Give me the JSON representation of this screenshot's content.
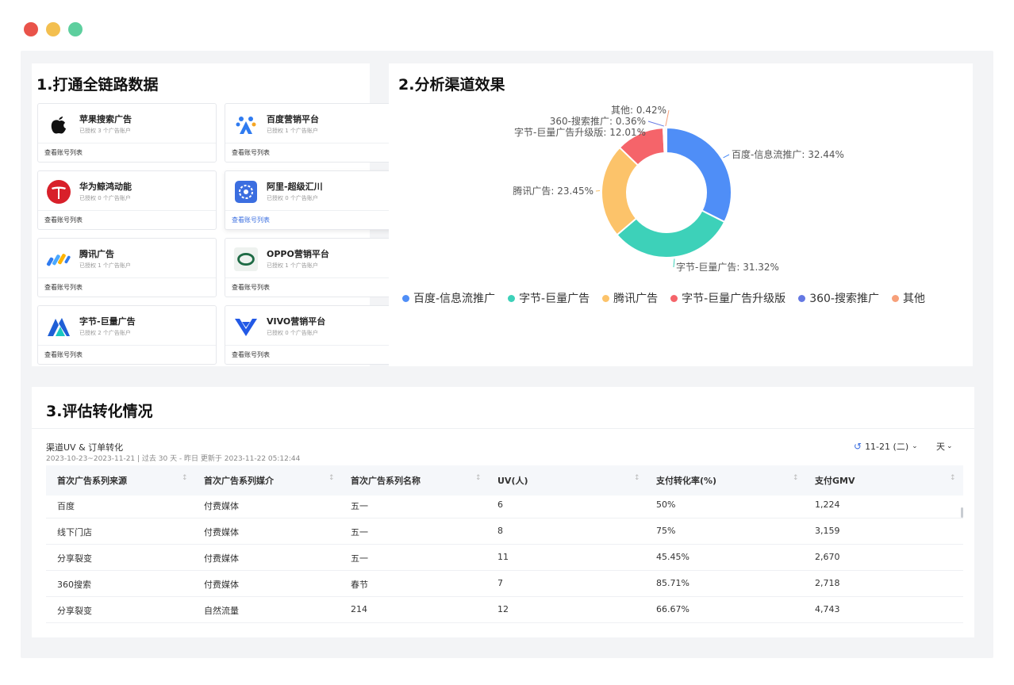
{
  "window": {
    "dots": [
      "#e9534a",
      "#f3bf4f",
      "#5dcf9e"
    ]
  },
  "section1": {
    "title": "1.打通全链路数据",
    "channels": [
      {
        "name": "苹果搜索广告",
        "sub": "已授权 3 个广告账户",
        "link": "查看账号列表",
        "icon": "apple-icon"
      },
      {
        "name": "百度营销平台",
        "sub": "已授权 1 个广告账户",
        "link": "查看账号列表",
        "icon": "baidu-icon"
      },
      {
        "name": "华为鲸鸿动能",
        "sub": "已授权 0 个广告账户",
        "link": "查看账号列表",
        "icon": "huawei-icon"
      },
      {
        "name": "阿里-超级汇川",
        "sub": "已授权 0 个广告账户",
        "link": "查看账号列表",
        "icon": "ali-icon"
      },
      {
        "name": "腾讯广告",
        "sub": "已授权 1 个广告账户",
        "link": "查看账号列表",
        "icon": "tencent-icon"
      },
      {
        "name": "OPPO营销平台",
        "sub": "已授权 1 个广告账户",
        "link": "查看账号列表",
        "icon": "oppo-icon"
      },
      {
        "name": "字节-巨量广告",
        "sub": "已授权 2 个广告账户",
        "link": "查看账号列表",
        "icon": "bytedance-icon"
      },
      {
        "name": "VIVO营销平台",
        "sub": "已授权 0 个广告账户",
        "link": "查看账号列表",
        "icon": "vivo-icon"
      }
    ]
  },
  "section2": {
    "title": "2.分析渠道效果",
    "chart_data": {
      "type": "pie",
      "donut": true,
      "legend_position": "bottom",
      "slices": [
        {
          "name": "百度-信息流推广",
          "value": 32.44,
          "label": "百度-信息流推广: 32.44%",
          "color": "#4f8ef7"
        },
        {
          "name": "字节-巨量广告",
          "value": 31.32,
          "label": "字节-巨量广告: 31.32%",
          "color": "#3dd1b9"
        },
        {
          "name": "腾讯广告",
          "value": 23.45,
          "label": "腾讯广告: 23.45%",
          "color": "#fcc36a"
        },
        {
          "name": "字节-巨量广告升级版",
          "value": 12.01,
          "label": "字节-巨量广告升级版: 12.01%",
          "color": "#f5646a"
        },
        {
          "name": "360-搜索推广",
          "value": 0.36,
          "label": "360-搜索推广: 0.36%",
          "color": "#6478e3"
        },
        {
          "name": "其他",
          "value": 0.42,
          "label": "其他: 0.42%",
          "color": "#f7a07a"
        }
      ]
    }
  },
  "section3": {
    "title": "3.评估转化情况",
    "report_title": "渠道UV & 订单转化",
    "report_meta": "2023-10-23~2023-11-21 | 过去 30 天 - 昨日 更新于 2023-11-22 05:12:44",
    "date_picker": "11-21 (二)",
    "granularity": "天",
    "columns": [
      "首次广告系列来源",
      "首次广告系列媒介",
      "首次广告系列名称",
      "UV(人)",
      "支付转化率(%)",
      "支付GMV"
    ],
    "rows": [
      [
        "百度",
        "付费媒体",
        "五一",
        "6",
        "50%",
        "1,224"
      ],
      [
        "线下门店",
        "付费媒体",
        "五一",
        "8",
        "75%",
        "3,159"
      ],
      [
        "分享裂变",
        "付费媒体",
        "五一",
        "11",
        "45.45%",
        "2,670"
      ],
      [
        "360搜索",
        "付费媒体",
        "春节",
        "7",
        "85.71%",
        "2,718"
      ],
      [
        "分享裂变",
        "自然流量",
        "214",
        "12",
        "66.67%",
        "4,743"
      ]
    ]
  }
}
